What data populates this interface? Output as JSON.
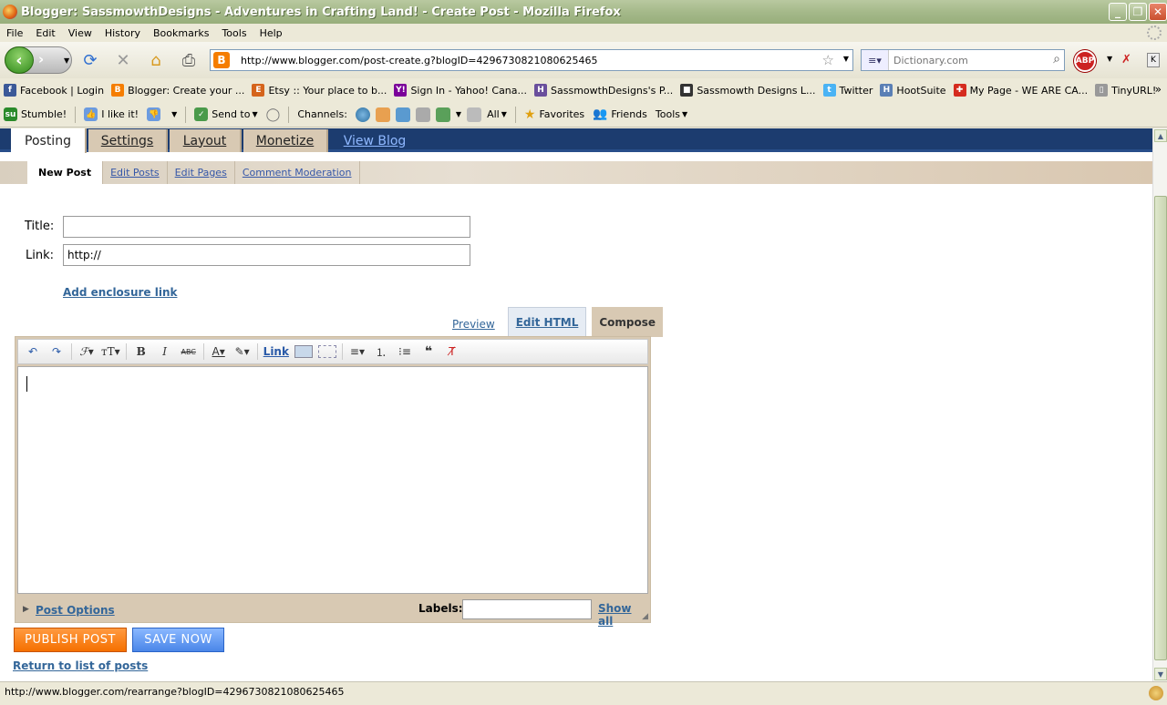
{
  "window": {
    "title": "Blogger: SassmowthDesigns - Adventures in Crafting Land! - Create Post - Mozilla Firefox",
    "min": "_",
    "max": "❐",
    "close": "✕"
  },
  "menu": {
    "file": "File",
    "edit": "Edit",
    "view": "View",
    "history": "History",
    "bookmarks": "Bookmarks",
    "tools": "Tools",
    "help": "Help"
  },
  "nav": {
    "url": "http://www.blogger.com/post-create.g?blogID=4296730821080625465",
    "search_placeholder": "Dictionary.com",
    "abp": "ABP"
  },
  "bookmarks": [
    {
      "label": "Facebook | Login",
      "icon": "f",
      "color": "#3b5998"
    },
    {
      "label": "Blogger: Create your ...",
      "icon": "B",
      "color": "#f57d00"
    },
    {
      "label": "Etsy :: Your place to b...",
      "icon": "E",
      "color": "#d5641c"
    },
    {
      "label": "Sign In - Yahoo! Cana...",
      "icon": "Y!",
      "color": "#7b0099"
    },
    {
      "label": "SassmowthDesigns's P...",
      "icon": "H",
      "color": "#6a4f9c"
    },
    {
      "label": "Sassmowth Designs L...",
      "icon": "■",
      "color": "#333"
    },
    {
      "label": "Twitter",
      "icon": "t",
      "color": "#4ab3f4"
    },
    {
      "label": "HootSuite",
      "icon": "H",
      "color": "#5a7fb5"
    },
    {
      "label": "My Page - WE ARE CA...",
      "icon": "✚",
      "color": "#d52b1e"
    },
    {
      "label": "TinyURL!",
      "icon": "▯",
      "color": "#999"
    }
  ],
  "stumble": {
    "stumble": "Stumble!",
    "like": "I like it!",
    "send": "Send to",
    "channels": "Channels:",
    "all": "All",
    "favorites": "Favorites",
    "friends": "Friends",
    "tools": "Tools"
  },
  "blogger": {
    "tabs": {
      "posting": "Posting",
      "settings": "Settings",
      "layout": "Layout",
      "monetize": "Monetize",
      "view_blog": "View Blog"
    },
    "subtabs": {
      "new_post": "New Post",
      "edit_posts": "Edit Posts",
      "edit_pages": "Edit Pages",
      "comment_moderation": "Comment Moderation"
    },
    "form": {
      "title_label": "Title:",
      "title_value": "",
      "link_label": "Link:",
      "link_value": "http://",
      "add_enclosure": "Add enclosure link"
    },
    "editor_tabs": {
      "preview": "Preview",
      "edit_html": "Edit HTML",
      "compose": "Compose"
    },
    "toolbar": {
      "link": "Link"
    },
    "footer": {
      "post_options": "Post Options",
      "labels": "Labels:",
      "labels_value": "",
      "show_all": "Show all"
    },
    "buttons": {
      "publish": "PUBLISH POST",
      "save": "SAVE NOW"
    },
    "return": "Return to list of posts"
  },
  "status": "http://www.blogger.com/rearrange?blogID=4296730821080625465"
}
